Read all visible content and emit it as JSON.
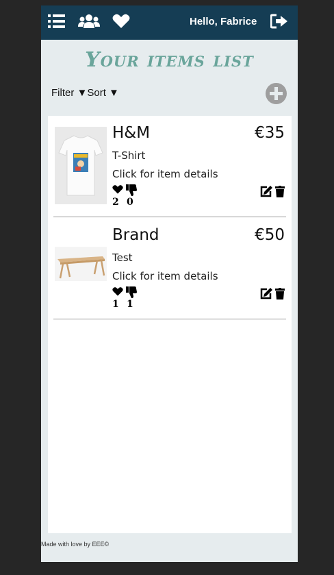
{
  "navbar": {
    "icons": [
      "list-icon",
      "users-icon",
      "heart-icon",
      "sign-out-icon"
    ],
    "greeting": "Hello, Fabrice"
  },
  "page": {
    "title": "Your items list"
  },
  "controls": {
    "filter_label": "Filter ▼",
    "sort_label": "Sort ▼",
    "add_icon": "plus-circle-icon"
  },
  "items": [
    {
      "brand": "H&M",
      "price": "€35",
      "category": "T-Shirt",
      "details_link": "Click for item details",
      "likes": "2",
      "dislikes": "0",
      "image": "white-tshirt-photo"
    },
    {
      "brand": "Brand",
      "price": "€50",
      "category": "Test",
      "details_link": "Click for item details",
      "likes": "1",
      "dislikes": "1",
      "image": "wooden-table-photo"
    }
  ],
  "footer": {
    "text": "Made with love by EEE©"
  },
  "colors": {
    "navbar": "#153d54",
    "title": "#6aa59b",
    "background": "#e6ecee",
    "outer": "#262626"
  }
}
